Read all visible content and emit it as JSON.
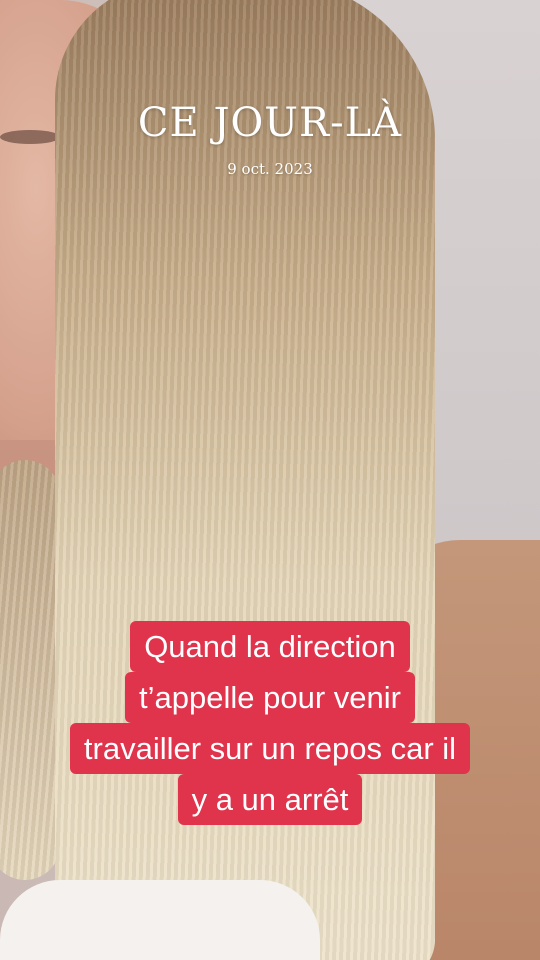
{
  "overlay": {
    "title": "CE JOUR-LÀ",
    "date": "9 oct. 2023"
  },
  "caption": {
    "lines": [
      "Quand la direction",
      "t’appelle pour venir",
      "travailler sur un repos car il",
      "y a un arrêt"
    ]
  },
  "colors": {
    "caption_background": "#e0334c",
    "caption_text": "#ffffff"
  }
}
